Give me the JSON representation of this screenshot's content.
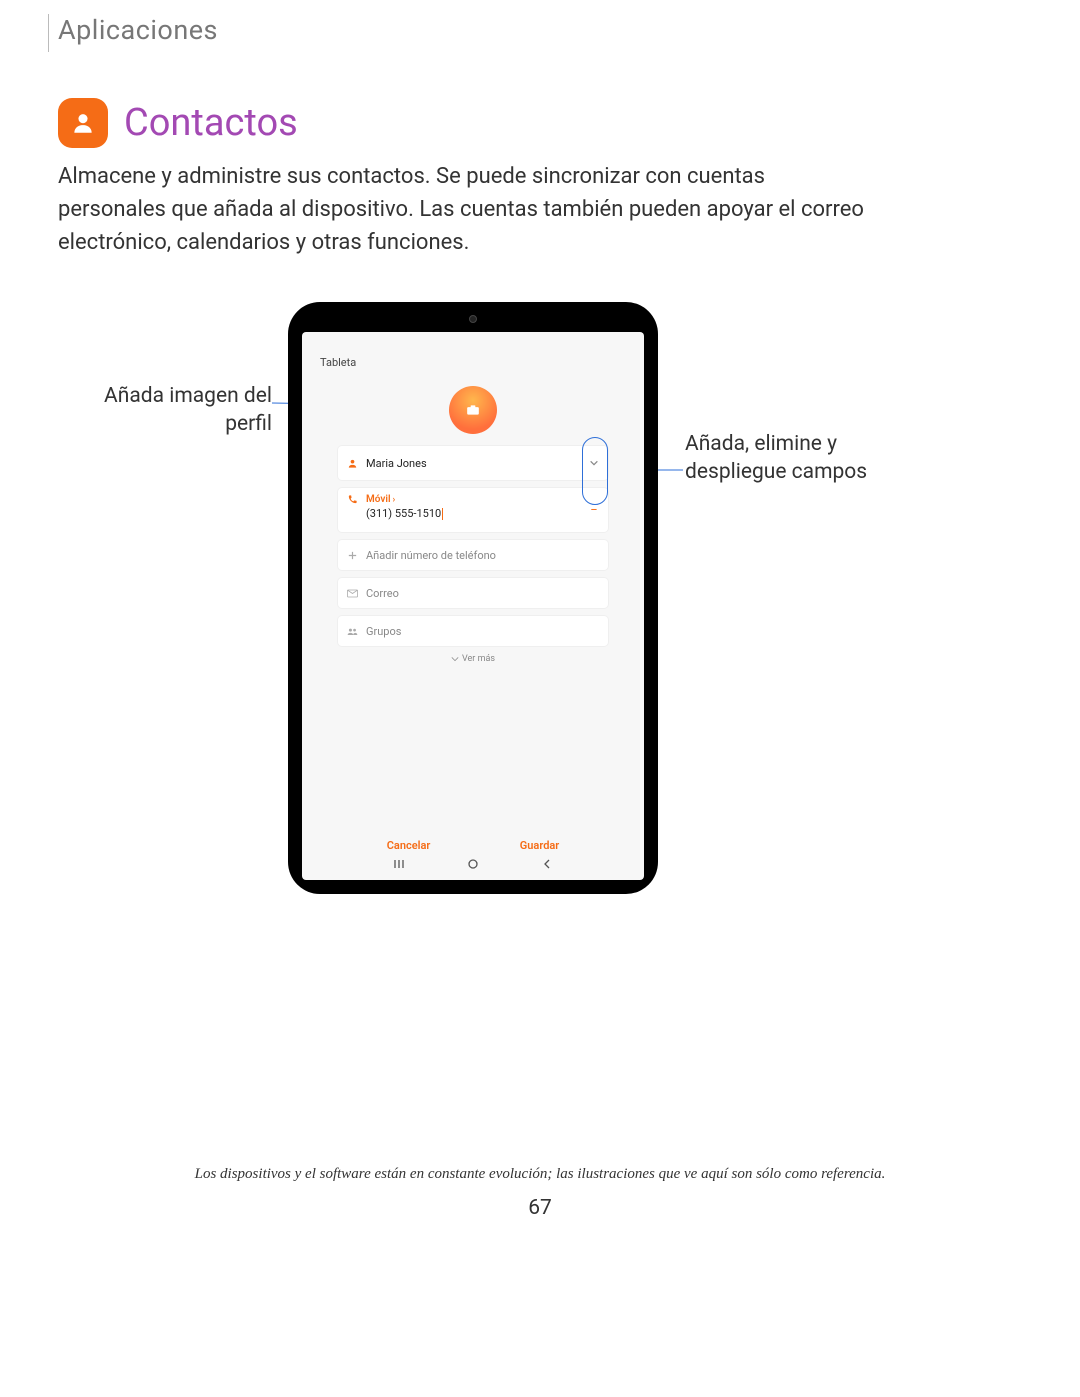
{
  "breadcrumb": "Aplicaciones",
  "title": "Contactos",
  "description": "Almacene y administre sus contactos. Se puede sincronizar con cuentas personales que añada al dispositivo. Las cuentas también pueden apoyar el correo electrónico, calendarios y otras funciones.",
  "callouts": {
    "left": "Añada imagen del perfil",
    "right": "Añada, elimine y despliegue campos"
  },
  "tablet": {
    "account_label": "Tableta",
    "fields": {
      "name_value": "Maria Jones",
      "phone_type": "Móvil",
      "phone_value": "(311) 555-1510",
      "add_phone_placeholder": "Añadir número de teléfono",
      "email_placeholder": "Correo",
      "groups_placeholder": "Grupos",
      "ver_mas": "Ver más"
    },
    "actions": {
      "cancel": "Cancelar",
      "save": "Guardar"
    }
  },
  "footnote": "Los dispositivos y el software están en constante evolución; las ilustraciones que ve aquí son sólo como referencia.",
  "page_number": "67"
}
